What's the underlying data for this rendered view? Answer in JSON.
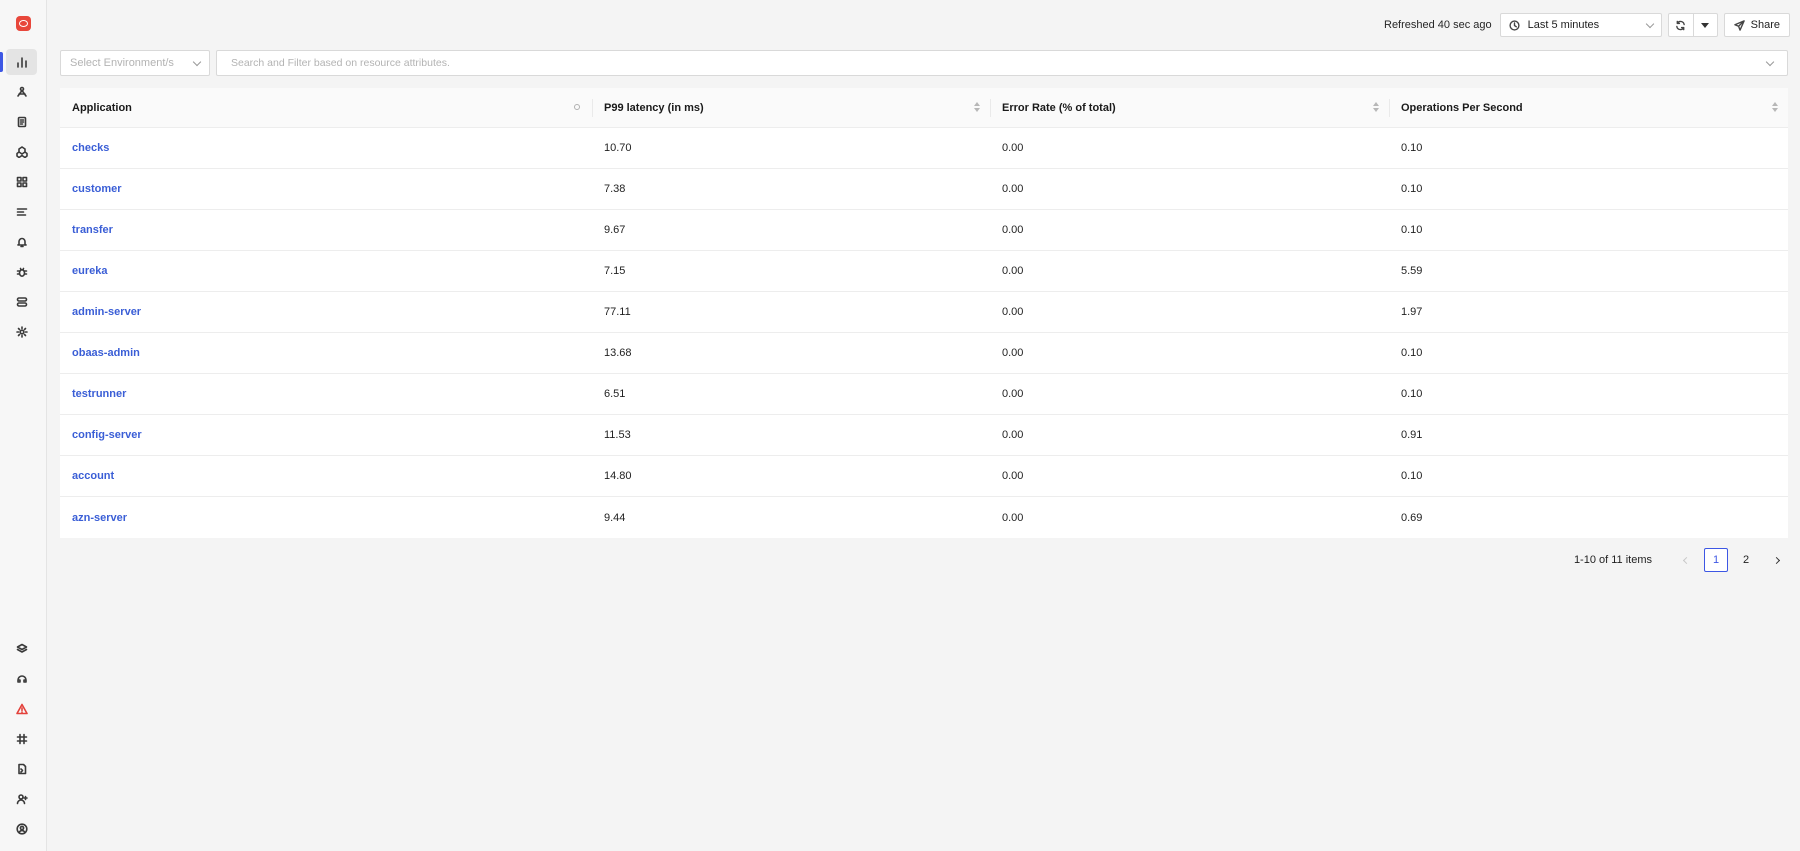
{
  "topbar": {
    "refreshed": "Refreshed 40 sec ago",
    "time_range": "Last 5 minutes",
    "share_label": "Share"
  },
  "filters": {
    "environment_placeholder": "Select Environment/s",
    "search_placeholder": "Search and Filter based on resource attributes."
  },
  "table": {
    "columns": [
      "Application",
      "P99 latency (in ms)",
      "Error Rate (% of total)",
      "Operations Per Second"
    ],
    "rows": [
      {
        "application": "checks",
        "p99": "10.70",
        "error_rate": "0.00",
        "ops": "0.10"
      },
      {
        "application": "customer",
        "p99": "7.38",
        "error_rate": "0.00",
        "ops": "0.10"
      },
      {
        "application": "transfer",
        "p99": "9.67",
        "error_rate": "0.00",
        "ops": "0.10"
      },
      {
        "application": "eureka",
        "p99": "7.15",
        "error_rate": "0.00",
        "ops": "5.59"
      },
      {
        "application": "admin-server",
        "p99": "77.11",
        "error_rate": "0.00",
        "ops": "1.97"
      },
      {
        "application": "obaas-admin",
        "p99": "13.68",
        "error_rate": "0.00",
        "ops": "0.10"
      },
      {
        "application": "testrunner",
        "p99": "6.51",
        "error_rate": "0.00",
        "ops": "0.10"
      },
      {
        "application": "config-server",
        "p99": "11.53",
        "error_rate": "0.00",
        "ops": "0.91"
      },
      {
        "application": "account",
        "p99": "14.80",
        "error_rate": "0.00",
        "ops": "0.10"
      },
      {
        "application": "azn-server",
        "p99": "9.44",
        "error_rate": "0.00",
        "ops": "0.69"
      }
    ]
  },
  "pagination": {
    "summary": "1-10 of 11 items",
    "pages": [
      "1",
      "2"
    ],
    "current": "1"
  },
  "sidebar": {
    "top_items": [
      "services-chart-icon",
      "traces-icon",
      "logs-icon",
      "infrastructure-icon",
      "dashboards-icon",
      "explorer-icon",
      "alerts-bell-icon",
      "exceptions-bug-icon",
      "pipelines-icon",
      "settings-gear-icon"
    ],
    "bottom_items": [
      "integrations-icon",
      "support-icon",
      "alert-warning-icon",
      "slack-icon",
      "docs-icon",
      "invite-member-icon",
      "user-profile-icon"
    ],
    "accent_color": "#3d57e4",
    "warning_color": "#e3413b"
  }
}
